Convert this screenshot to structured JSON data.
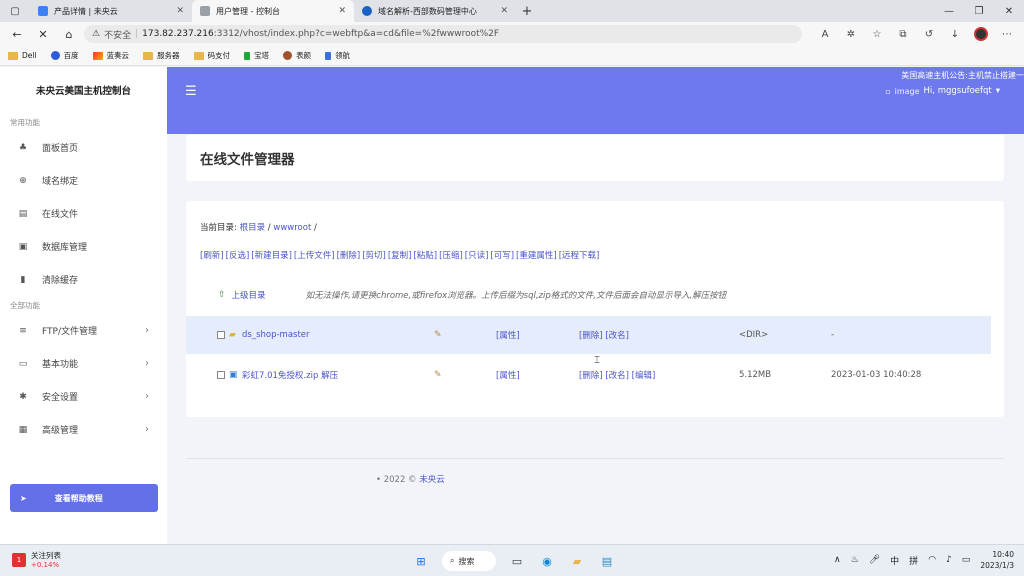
{
  "browser": {
    "tabs": [
      {
        "title": "产品详情 | 未央云",
        "color": "#3b82f6"
      },
      {
        "title": "用户管理 - 控制台",
        "color": "#9aa0a6"
      },
      {
        "title": "域名解析-西部数码管理中心",
        "color": "#1a62c6"
      }
    ],
    "security_label": "不安全",
    "url_host": "173.82.237.216",
    "url_rest": ":3312/vhost/index.php?c=webftp&a=cd&file=%2fwwwroot%2F",
    "bookmarks": [
      "Dell",
      "百度",
      "蓝奏云",
      "服务器",
      "码支付",
      "宝塔",
      "表颜",
      "领航"
    ]
  },
  "sidebar": {
    "brand": "未央云美国主机控制台",
    "section_common": "常用功能",
    "common_items": [
      {
        "label": "面板首页",
        "icon": "sitemap-icon"
      },
      {
        "label": "域名绑定",
        "icon": "globe-icon"
      },
      {
        "label": "在线文件",
        "icon": "file-icon"
      },
      {
        "label": "数据库管理",
        "icon": "database-icon"
      },
      {
        "label": "清除缓存",
        "icon": "trash-icon"
      }
    ],
    "section_all": "全部功能",
    "all_items": [
      {
        "label": "FTP/文件管理",
        "icon": "list-icon"
      },
      {
        "label": "基本功能",
        "icon": "card-icon"
      },
      {
        "label": "安全设置",
        "icon": "gear-icon"
      },
      {
        "label": "高级管理",
        "icon": "server-icon"
      }
    ],
    "help_button": "查看帮助教程"
  },
  "header": {
    "notice": "美国高速主机公告:主机禁止搭建一",
    "user_image_alt": "image",
    "user_greeting": "Hi, mggsufoefqt"
  },
  "page": {
    "title": "在线文件管理器",
    "current_dir_label": "当前目录:",
    "dir_root": "根目录",
    "dir_sep": " / ",
    "dir_current": "wwwroot",
    "dir_trail": " /",
    "actions": [
      "[刷新]",
      "[反选]",
      "[新建目录]",
      "[上传文件]",
      "[删除]",
      "[剪切]",
      "[复制]",
      "[粘贴]",
      "[压缩]",
      "[只读]",
      "[可写]",
      "[重建属性]",
      "[远程下载]"
    ],
    "up_dir": "上级目录",
    "hint": "如无法操作,请更换chrome,或firefox浏览器。上传后缀为sql,zip格式的文件,文件后面会自动显示导入,解压按钮",
    "files": [
      {
        "name": "ds_shop-master",
        "extra": "",
        "attr": "[属性]",
        "ops": "[删除] [改名]",
        "size": "<DIR>",
        "date": "-"
      },
      {
        "name": "彩虹7.01免授权.zip",
        "extra": "解压",
        "attr": "[属性]",
        "ops": "[删除] [改名] [编辑]",
        "size": "5.12MB",
        "date": "2023-01-03 10:40:28"
      }
    ]
  },
  "footer": {
    "prefix": "•  2022 ©",
    "brand": "未央云"
  },
  "taskbar": {
    "stock_label": "关注列表",
    "stock_change": "+0.14%",
    "stock_badge": "1",
    "search": "搜索",
    "ime1": "中",
    "ime2": "拼",
    "time": "10:40",
    "date": "2023/1/3"
  }
}
